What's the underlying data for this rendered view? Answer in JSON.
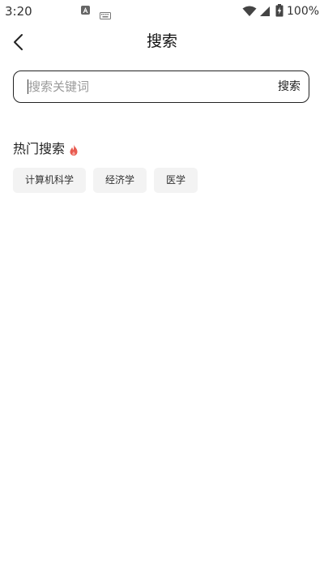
{
  "status_bar": {
    "time": "3:20",
    "battery": "100%",
    "icons": [
      "notification-a-icon",
      "keyboard-icon",
      "wifi-icon",
      "signal-icon",
      "battery-charging-icon"
    ]
  },
  "header": {
    "title": "搜索",
    "back_icon": "chevron-left-icon"
  },
  "search": {
    "placeholder": "搜索关键词",
    "value": "",
    "button_label": "搜索"
  },
  "hot_search": {
    "title": "热门搜索",
    "icon": "fire-icon",
    "icon_color": "#e85a4f",
    "tags": [
      "计算机科学",
      "经济学",
      "医学"
    ]
  }
}
